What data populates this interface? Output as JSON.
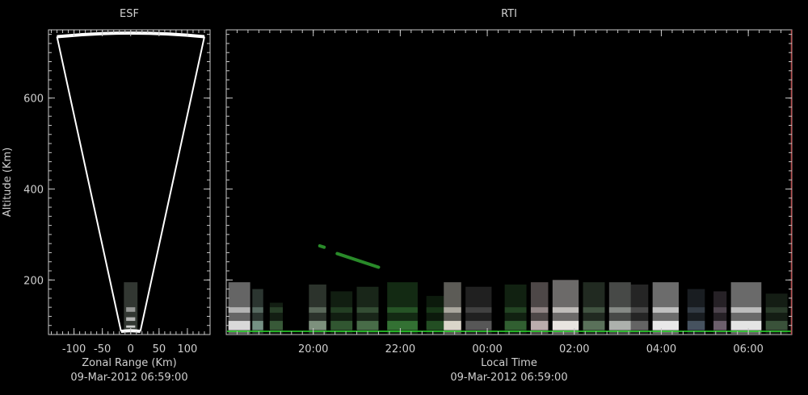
{
  "colors": {
    "background": "#000000",
    "axis": "#c8c8c8",
    "text": "#cfcfcf",
    "fan": "#ffffff",
    "rti_right_edge": "#b85050",
    "ground_line": "#2bd62b"
  },
  "chart_data": [
    {
      "type": "other",
      "title": "ESF",
      "xlabel": "Zonal Range (Km)",
      "ylabel": "Altitude (Km)",
      "caption": "09-Mar-2012 06:59:00",
      "xlim": [
        -145,
        140
      ],
      "ylim": [
        80,
        750
      ],
      "xticks": [
        -100,
        -50,
        0,
        50,
        100
      ],
      "xtick_labels": [
        "-100",
        "-50",
        "0",
        "50",
        "100"
      ],
      "yticks": [
        200,
        400,
        600
      ],
      "ytick_labels": [
        "200",
        "400",
        "600"
      ],
      "fan": {
        "apex_altitude": 87,
        "top_altitude": 743,
        "half_width_top": 130,
        "half_width_base": 17
      },
      "echo_band": {
        "x_min": -12,
        "x_max": 12,
        "alt_min": 88,
        "alt_max": 195
      }
    },
    {
      "type": "heatmap",
      "title": "RTI",
      "xlabel": "Local Time",
      "caption": "09-Mar-2012 06:59:00",
      "xlim": [
        18.0,
        31.0
      ],
      "ylim": [
        80,
        750
      ],
      "xticks": [
        20,
        22,
        24,
        26,
        28,
        30
      ],
      "xtick_labels": [
        "20:00",
        "22:00",
        "00:00",
        "02:00",
        "04:00",
        "06:00"
      ],
      "yticks": [
        200,
        400,
        600
      ],
      "echo_columns": [
        {
          "t0": 18.05,
          "t1": 18.55,
          "top": 195,
          "color": "#d9d9d9",
          "alpha": 0.85
        },
        {
          "t0": 18.6,
          "t1": 18.85,
          "top": 180,
          "color": "#8fb0a0",
          "alpha": 0.55
        },
        {
          "t0": 19.0,
          "t1": 19.3,
          "top": 150,
          "color": "#4d7a4d",
          "alpha": 0.45
        },
        {
          "t0": 19.9,
          "t1": 20.3,
          "top": 190,
          "color": "#9fb89f",
          "alpha": 0.5
        },
        {
          "t0": 20.4,
          "t1": 20.9,
          "top": 175,
          "color": "#3e6e3e",
          "alpha": 0.5
        },
        {
          "t0": 21.0,
          "t1": 21.5,
          "top": 185,
          "color": "#5c8a5c",
          "alpha": 0.5
        },
        {
          "t0": 21.7,
          "t1": 22.4,
          "top": 195,
          "color": "#3f8a3f",
          "alpha": 0.55
        },
        {
          "t0": 22.6,
          "t1": 23.0,
          "top": 165,
          "color": "#2f6a2f",
          "alpha": 0.45
        },
        {
          "t0": 23.0,
          "t1": 23.4,
          "top": 195,
          "color": "#e0dcd0",
          "alpha": 0.75
        },
        {
          "t0": 23.5,
          "t1": 24.1,
          "top": 185,
          "color": "#6a6a6a",
          "alpha": 0.55
        },
        {
          "t0": 24.4,
          "t1": 24.9,
          "top": 190,
          "color": "#3f7a3f",
          "alpha": 0.5
        },
        {
          "t0": 25.0,
          "t1": 25.4,
          "top": 195,
          "color": "#c8b8b8",
          "alpha": 0.7
        },
        {
          "t0": 25.5,
          "t1": 26.1,
          "top": 200,
          "color": "#e8e4e0",
          "alpha": 0.85
        },
        {
          "t0": 26.2,
          "t1": 26.7,
          "top": 195,
          "color": "#6e8a6e",
          "alpha": 0.55
        },
        {
          "t0": 26.8,
          "t1": 27.3,
          "top": 195,
          "color": "#b8bdb8",
          "alpha": 0.7
        },
        {
          "t0": 27.3,
          "t1": 27.7,
          "top": 190,
          "color": "#7a7a7a",
          "alpha": 0.55
        },
        {
          "t0": 27.8,
          "t1": 28.4,
          "top": 195,
          "color": "#e8e8e8",
          "alpha": 0.85
        },
        {
          "t0": 28.6,
          "t1": 29.0,
          "top": 180,
          "color": "#5a6a7a",
          "alpha": 0.5
        },
        {
          "t0": 29.2,
          "t1": 29.5,
          "top": 175,
          "color": "#8a7a8a",
          "alpha": 0.5
        },
        {
          "t0": 29.6,
          "t1": 30.3,
          "top": 195,
          "color": "#e4e4e4",
          "alpha": 0.85
        },
        {
          "t0": 30.4,
          "t1": 30.9,
          "top": 170,
          "color": "#4a6a4a",
          "alpha": 0.5
        }
      ],
      "streaks": [
        {
          "t0": 20.55,
          "a0": 258,
          "t1": 21.5,
          "a1": 228,
          "color": "#2e9a2e"
        },
        {
          "t0": 20.15,
          "a0": 275,
          "t1": 20.25,
          "a1": 272,
          "color": "#2e9a2e"
        }
      ]
    }
  ]
}
